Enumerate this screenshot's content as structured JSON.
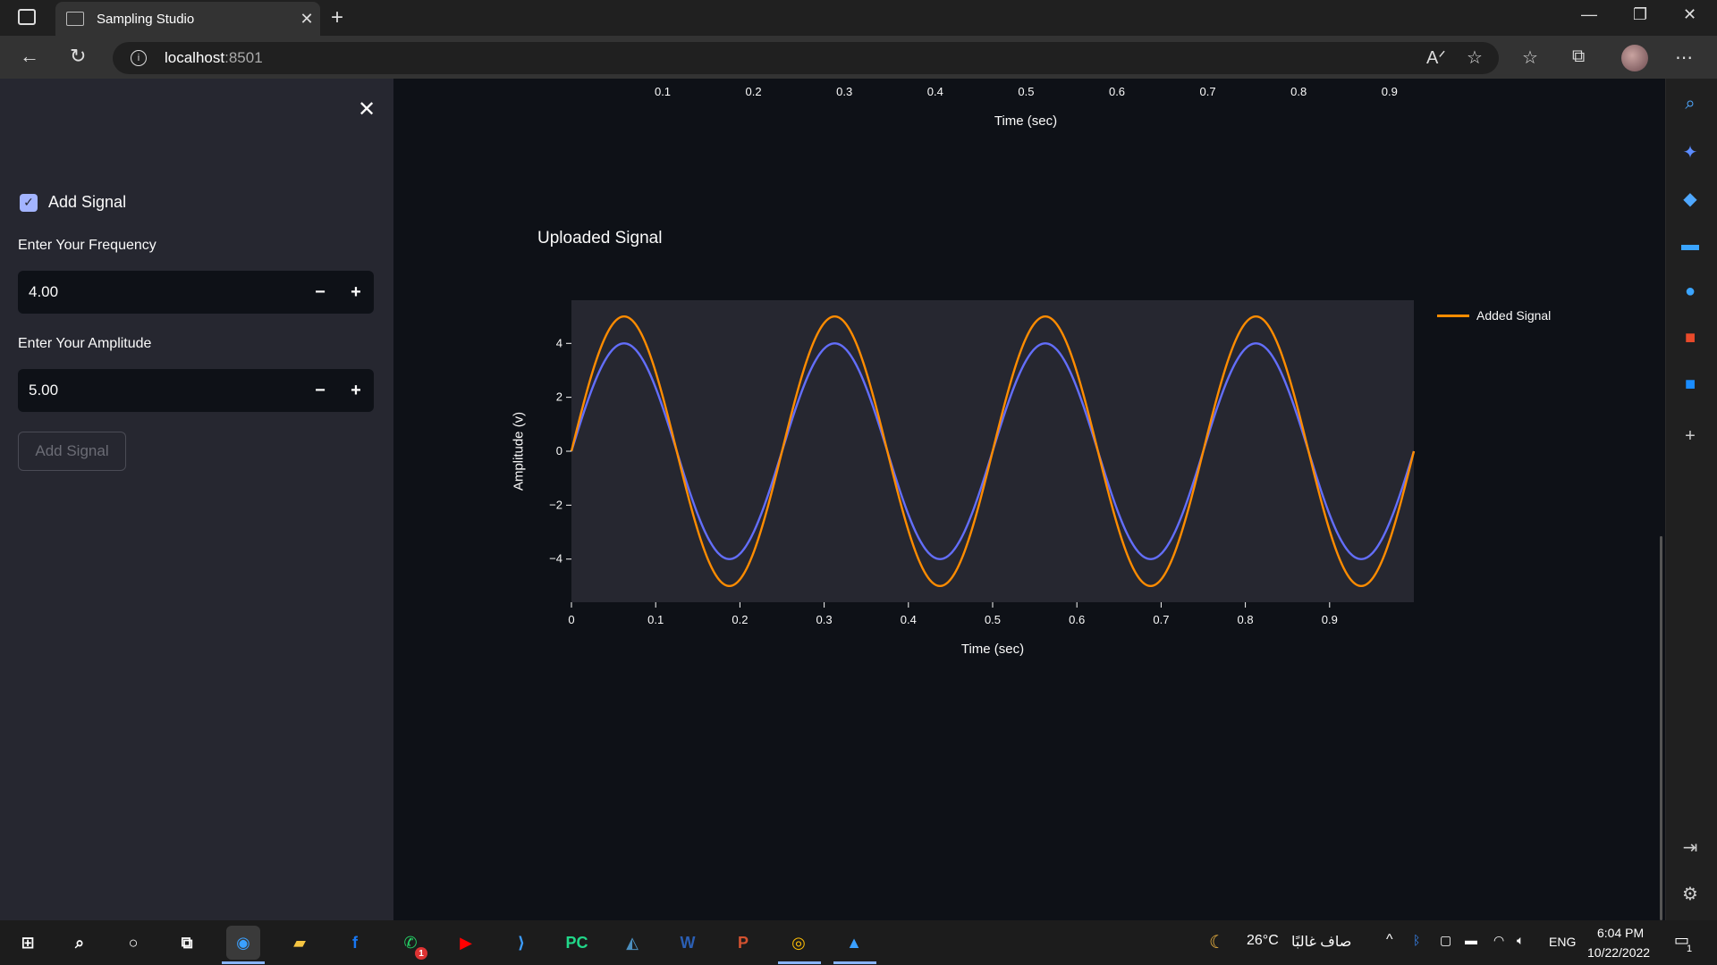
{
  "browser": {
    "tab_title": "Sampling Studio",
    "url_host": "localhost",
    "url_port": ":8501"
  },
  "sidebar": {
    "checkbox_label": "Add Signal",
    "checkbox_checked": true,
    "frequency_label": "Enter Your Frequency",
    "frequency_value": "4.00",
    "amplitude_label": "Enter Your Amplitude",
    "amplitude_value": "5.00",
    "add_button_label": "Add Signal",
    "minus": "−",
    "plus": "+"
  },
  "top_chart_partial": {
    "tick_labels": [
      "0.1",
      "0.2",
      "0.3",
      "0.4",
      "0.5",
      "0.6",
      "0.7",
      "0.8",
      "0.9"
    ],
    "xlabel": "Time (sec)"
  },
  "chart_data": {
    "type": "line",
    "title": "Uploaded Signal",
    "xlabel": "Time (sec)",
    "ylabel": "Amplitude (v)",
    "xlim": [
      0,
      1
    ],
    "ylim": [
      -5.6,
      5.6
    ],
    "x_ticks": [
      "0",
      "0.1",
      "0.2",
      "0.3",
      "0.4",
      "0.5",
      "0.6",
      "0.7",
      "0.8",
      "0.9"
    ],
    "y_ticks": [
      "4",
      "2",
      "0",
      "−2",
      "−4"
    ],
    "series": [
      {
        "name": "",
        "color": "#636efa",
        "function": "sine",
        "frequency": 4,
        "amplitude": 4
      },
      {
        "name": "Added Signal",
        "color": "#ff8c00",
        "function": "sine",
        "frequency": 4,
        "amplitude": 5
      }
    ],
    "legend": "right",
    "plot_bg": "#262730",
    "grid": false
  },
  "taskbar": {
    "weather_temp": "26°C",
    "weather_text": "صاف غالبًا",
    "lang": "ENG",
    "time": "6:04 PM",
    "date": "10/22/2022",
    "notif_count": "1",
    "whatsapp_badge": "1"
  }
}
